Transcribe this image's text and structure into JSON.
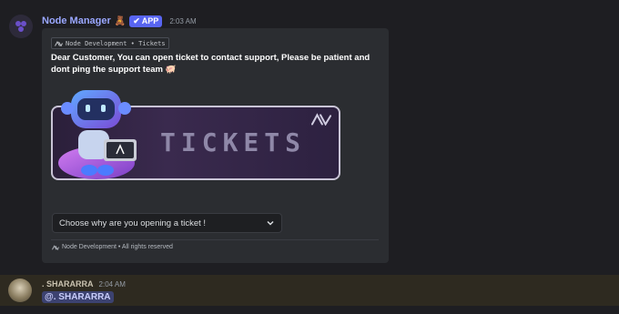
{
  "message1": {
    "username": "Node Manager",
    "badge_emoji": "🧸",
    "app_tag": "APP",
    "timestamp": "2:03 AM",
    "embed": {
      "author": "Node Development • Tickets",
      "description": "Dear Customer, You can open ticket to contact support, Please be patient and dont ping the support team 🐖",
      "banner_text": "TICKETS",
      "select_placeholder": "Choose why are you opening a ticket !",
      "footer": "Node Development • All rights reserved"
    }
  },
  "message2": {
    "username": ". SHARARRA",
    "timestamp": "2:04 AM",
    "mention": "@. SHARARRA"
  },
  "colors": {
    "background": "#1e1e22",
    "embed_bg": "#2b2d31",
    "app_tag": "#5865f2",
    "username": "#9aa7ff",
    "highlight_row": "#2e2a20",
    "mention_bg": "#3c4270"
  }
}
